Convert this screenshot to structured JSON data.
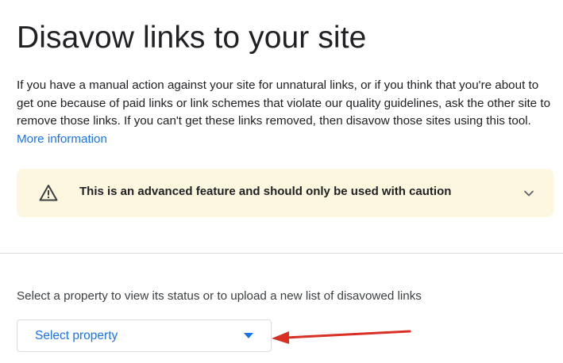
{
  "page": {
    "title": "Disavow links to your site"
  },
  "intro": {
    "text": "If you have a manual action against your site for unnatural links, or if you think that you're about to get one because of paid links or link schemes that violate our quality guidelines, ask the other site to remove those links. If you can't get these links removed, then disavow those sites using this tool.",
    "link_label": "More information"
  },
  "warning": {
    "icon": "warning-triangle-icon",
    "text": "This is an advanced feature and should only be used with caution",
    "expand_icon": "chevron-down-icon",
    "background_color": "#fef7e0"
  },
  "property_section": {
    "label": "Select a property to view its status or to upload a new list of disavowed links",
    "select_placeholder": "Select property",
    "dropdown_icon": "caret-down-icon"
  },
  "colors": {
    "accent": "#1a73e8",
    "annotation_arrow": "#d93025"
  }
}
